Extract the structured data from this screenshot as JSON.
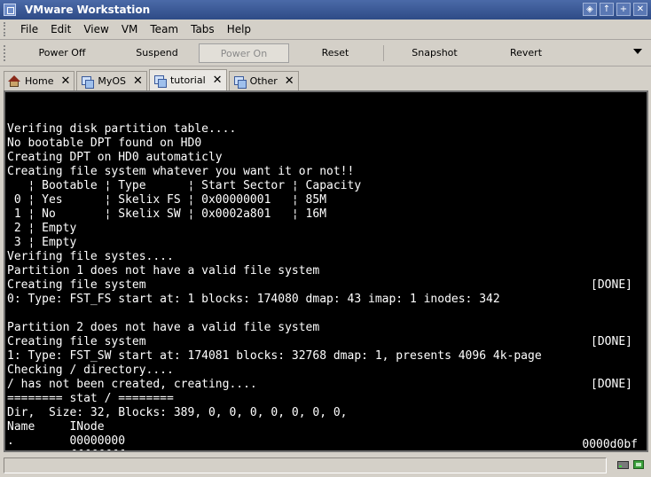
{
  "window": {
    "title": "VMware Workstation",
    "controls": [
      "◈",
      "↑",
      "+",
      "✕"
    ]
  },
  "menu": [
    "File",
    "Edit",
    "View",
    "VM",
    "Team",
    "Tabs",
    "Help"
  ],
  "toolbar": {
    "power_off": "Power Off",
    "suspend": "Suspend",
    "power_on": "Power On",
    "reset": "Reset",
    "snapshot": "Snapshot",
    "revert": "Revert"
  },
  "tabs": [
    {
      "label": "Home",
      "icon": "home-icon",
      "active": false
    },
    {
      "label": "MyOS",
      "icon": "vm-icon",
      "active": false
    },
    {
      "label": "tutorial",
      "icon": "vm-icon",
      "active": true
    },
    {
      "label": "Other",
      "icon": "vm-icon",
      "active": false
    }
  ],
  "console": {
    "lines": [
      {
        "text": "Verifing disk partition table....",
        "right": ""
      },
      {
        "text": "No bootable DPT found on HD0",
        "right": ""
      },
      {
        "text": "Creating DPT on HD0 automaticly",
        "right": ""
      },
      {
        "text": "Creating file system whatever you want it or not!!",
        "right": ""
      },
      {
        "text": "   ¦ Bootable ¦ Type      ¦ Start Sector ¦ Capacity",
        "right": ""
      },
      {
        "text": " 0 ¦ Yes      ¦ Skelix FS ¦ 0x00000001   ¦ 85M",
        "right": ""
      },
      {
        "text": " 1 ¦ No       ¦ Skelix SW ¦ 0x0002a801   ¦ 16M",
        "right": ""
      },
      {
        "text": " 2 ¦ Empty",
        "right": ""
      },
      {
        "text": " 3 ¦ Empty",
        "right": ""
      },
      {
        "text": "Verifing file systes....",
        "right": ""
      },
      {
        "text": "Partition 1 does not have a valid file system",
        "right": ""
      },
      {
        "text": "Creating file system",
        "right": "[DONE]"
      },
      {
        "text": "0: Type: FST_FS start at: 1 blocks: 174080 dmap: 43 imap: 1 inodes: 342",
        "right": ""
      },
      {
        "text": "",
        "right": ""
      },
      {
        "text": "Partition 2 does not have a valid file system",
        "right": ""
      },
      {
        "text": "Creating file system",
        "right": "[DONE]"
      },
      {
        "text": "1: Type: FST_SW start at: 174081 blocks: 32768 dmap: 1, presents 4096 4k-page",
        "right": ""
      },
      {
        "text": "Checking / directory....",
        "right": ""
      },
      {
        "text": "/ has not been created, creating....",
        "right": "[DONE]"
      },
      {
        "text": "======== stat / ========",
        "right": ""
      },
      {
        "text": "Dir,  Size: 32, Blocks: 389, 0, 0, 0, 0, 0, 0, 0,",
        "right": ""
      },
      {
        "text": "Name     INode",
        "right": ""
      },
      {
        "text": ".        00000000",
        "right": ""
      },
      {
        "text": "..       ffffffff",
        "right": ""
      }
    ],
    "bottom_left": "=¬€",
    "bottom_right": "0000d0bf"
  }
}
